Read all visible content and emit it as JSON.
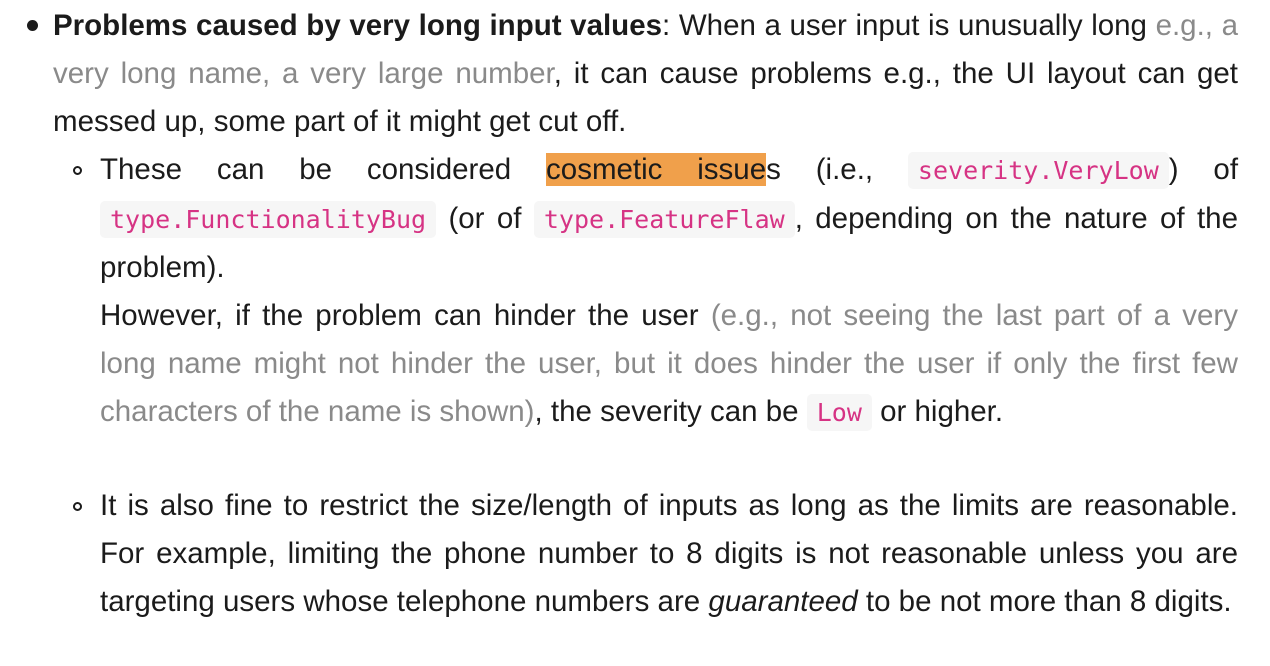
{
  "item1": {
    "title": "Problems caused by very long input values",
    "t1": ": When a user input is unusually long ",
    "example": "e.g., a very long name, a very large number",
    "t2": ", it can cause problems e.g., the UI layout can get messed up, some part of it might get cut off."
  },
  "item2": {
    "t1": "These can be considered ",
    "highlight": "cosmetic issue",
    "t2": "s (i.e., ",
    "code1": "severity.VeryLow",
    "t3": ") of ",
    "code2": "type.FunctionalityBug",
    "t4": " (or of ",
    "code3": "type.FeatureFlaw",
    "t5": ", depending on the nature of the problem).",
    "t6": "However, if the problem can hinder the user ",
    "aside": "(e.g., not seeing the last part of a very long name might not hinder the user, but it does hinder the user if only the first few characters of the name is shown)",
    "t7": ", the severity can be ",
    "code4": "Low",
    "t8": " or higher."
  },
  "item3": {
    "t1": "It is also fine to restrict the size/length of inputs as long as the limits are reasonable. For example, limiting the phone number to 8 digits is not reasonable unless you are targeting users whose telephone numbers are ",
    "emph": "guaranteed",
    "t2": " to be not more than 8 digits."
  }
}
